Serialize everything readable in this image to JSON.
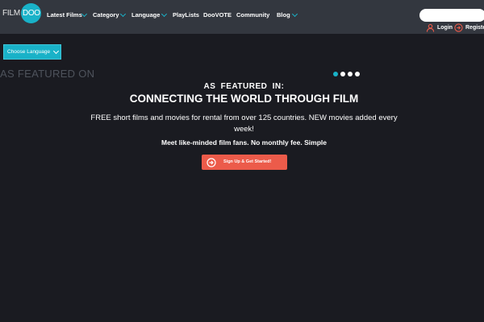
{
  "header": {
    "logo": {
      "left_text": "FILM",
      "right_text": "DOO"
    },
    "nav": [
      {
        "label": "Latest Films",
        "dropdown": true
      },
      {
        "label": "Category",
        "dropdown": true
      },
      {
        "label": "Language",
        "dropdown": true
      },
      {
        "label": "PlayLists",
        "dropdown": false
      },
      {
        "label": "DooVOTE",
        "dropdown": false
      },
      {
        "label": "Community",
        "dropdown": false
      },
      {
        "label": "Blog",
        "dropdown": true
      }
    ],
    "search": {
      "placeholder": "",
      "value": ""
    },
    "auth": {
      "login_label": "Login",
      "register_label": "Registe"
    }
  },
  "language_button": {
    "label": "Choose Language"
  },
  "featured_on_label": "AS FEATURED ON",
  "carousel": {
    "slide_count": 4,
    "active_index": 0
  },
  "hero": {
    "eyebrow": "AS FEATURED IN:",
    "headline": "CONNECTING THE WORLD THROUGH FILM",
    "subtitle": "FREE short films and movies for rental from over 125 countries.   NEW movies added every week!",
    "tagline": "Meet like-minded film fans. No monthly fee. Simple"
  },
  "cta": {
    "label": "Sign Up & Get Started!"
  },
  "colors": {
    "header_bg": "#33373f",
    "page_bg": "#1a1b21",
    "accent": "#19b2c8",
    "cta": "#ec5b4a",
    "muted_text": "#4e535c"
  }
}
